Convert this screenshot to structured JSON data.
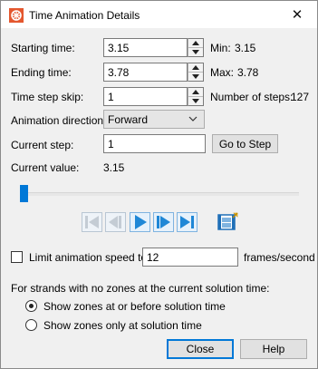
{
  "window": {
    "title": "Time Animation Details",
    "close_glyph": "✕"
  },
  "starting_time": {
    "label": "Starting time:",
    "value": "3.15",
    "min_label": "Min:",
    "min_value": "3.15"
  },
  "ending_time": {
    "label": "Ending time:",
    "value": "3.78",
    "max_label": "Max:",
    "max_value": "3.78"
  },
  "time_step_skip": {
    "label": "Time step skip:",
    "value": "1",
    "steps_label": "Number of steps:",
    "steps_value": "127"
  },
  "animation_direction": {
    "label": "Animation direction:",
    "selected": "Forward"
  },
  "current_step": {
    "label": "Current step:",
    "value": "1",
    "go_button": "Go to Step"
  },
  "current_value": {
    "label": "Current value:",
    "value": "3.15"
  },
  "slider": {
    "position": 0.0
  },
  "transport": {
    "icons": [
      "first-step-icon",
      "previous-step-icon",
      "play-icon",
      "next-step-icon",
      "last-step-icon",
      "export-animation-icon"
    ],
    "enabled": [
      false,
      false,
      true,
      true,
      true,
      true
    ],
    "accent": "#1f87d6"
  },
  "limit_speed": {
    "label": "Limit animation speed to",
    "checked": false,
    "value": "12",
    "unit": "frames/second"
  },
  "strands": {
    "label": "For strands with no zones at the current solution time:",
    "option_before": "Show zones at or before solution time",
    "option_only": "Show zones only at solution time",
    "selected": "before"
  },
  "buttons": {
    "close": "Close",
    "help": "Help"
  },
  "colors": {
    "accent": "#0078d7",
    "dialog_bg": "#f0f0f0"
  }
}
